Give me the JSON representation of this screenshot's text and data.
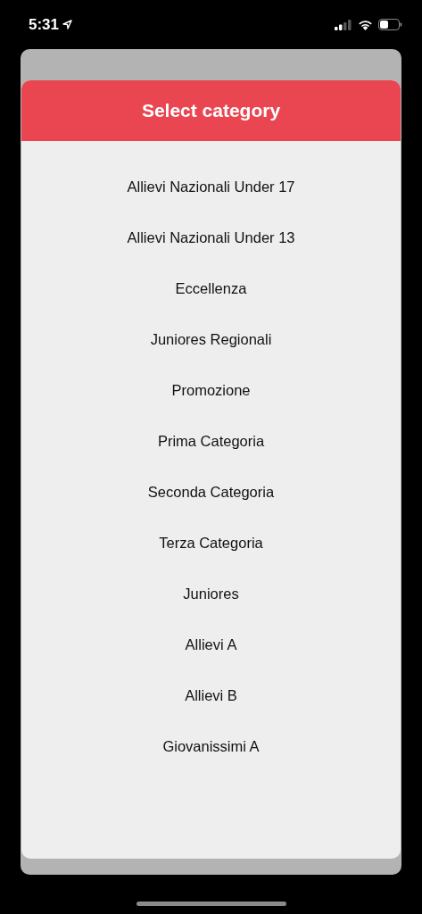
{
  "status_bar": {
    "time": "5:31"
  },
  "dialog": {
    "title": "Select category",
    "items": [
      {
        "label": "Allievi Nazionali Under 17"
      },
      {
        "label": "Allievi Nazionali Under 13"
      },
      {
        "label": "Eccellenza"
      },
      {
        "label": "Juniores Regionali"
      },
      {
        "label": "Promozione"
      },
      {
        "label": "Prima Categoria"
      },
      {
        "label": "Seconda Categoria"
      },
      {
        "label": "Terza Categoria"
      },
      {
        "label": "Juniores"
      },
      {
        "label": "Allievi A"
      },
      {
        "label": "Allievi B"
      },
      {
        "label": "Giovanissimi A"
      }
    ]
  }
}
